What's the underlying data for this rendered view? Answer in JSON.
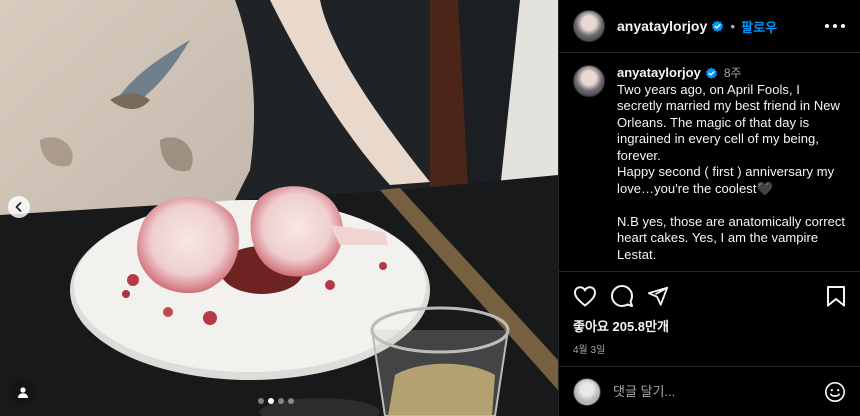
{
  "post": {
    "username": "anyataylorjoy",
    "follow_label": "팔로우",
    "separator": "•",
    "time_ago": "8주",
    "caption": "Two years ago, on April Fools, I secretly married my best friend in New Orleans. The magic of that day is ingrained in every cell of my being, forever.\nHappy second ( first ) anniversary my love…you're the coolest🖤\n\nN.B yes, those are anatomically correct heart cakes. Yes, I am the vampire Lestat.",
    "likes": "좋아요 205.8만개",
    "date": "4월 3일",
    "comment_placeholder": "댓글 달기...",
    "carousel": {
      "count": 4,
      "active_index": 1
    }
  },
  "icons": {
    "verified": "verified-badge-icon",
    "more": "more-options-icon",
    "like": "heart-icon",
    "comment": "comment-icon",
    "share": "share-icon",
    "save": "bookmark-icon",
    "emoji": "emoji-icon",
    "prev": "chevron-left-icon",
    "user_tag": "user-tag-icon"
  },
  "colors": {
    "accent": "#0095f6",
    "background": "#000000",
    "text": "#f5f5f5",
    "muted": "#a8a8a8"
  }
}
